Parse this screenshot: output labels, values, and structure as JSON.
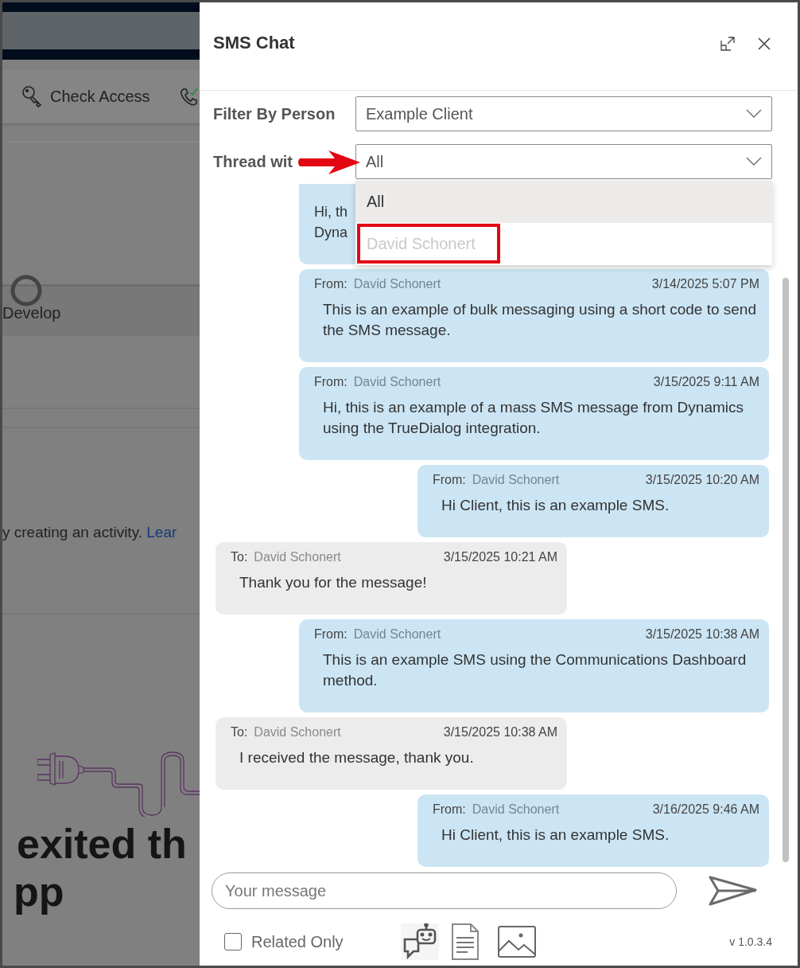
{
  "background": {
    "toolbar": [
      {
        "kind": "key",
        "label": "Check Access"
      },
      {
        "kind": "phone"
      }
    ],
    "stage": "Develop",
    "notice": {
      "text": "y creating an activity. ",
      "link": "Lear"
    },
    "heading": [
      "exited th",
      "pp"
    ]
  },
  "panel": {
    "title": "SMS Chat",
    "filters": [
      {
        "label": "Filter By Person",
        "value": "Example Client"
      },
      {
        "label": "Thread wit",
        "value": "All",
        "expanded": true
      }
    ],
    "options": [
      {
        "label": "All",
        "selected": true,
        "annotated": false
      },
      {
        "label": "David Schonert",
        "selected": false,
        "annotated": true
      }
    ],
    "messages": [
      {
        "kind": "out",
        "text": "Hi, th\nDyna"
      },
      {
        "kind": "out",
        "prefix": "From:",
        "name": "David Schonert",
        "time": "3/14/2025 5:07 PM",
        "text": "This is an example of bulk messaging using a short code to send the SMS message."
      },
      {
        "kind": "out",
        "prefix": "From:",
        "name": "David Schonert",
        "time": "3/15/2025 9:11 AM",
        "text": "Hi, this is an example of a mass SMS message from Dynamics using the TrueDialog integration."
      },
      {
        "kind": "out",
        "prefix": "From:",
        "name": "David Schonert",
        "time": "3/15/2025 10:20 AM",
        "text": "Hi Client, this is an example SMS."
      },
      {
        "kind": "in",
        "prefix": "To:",
        "name": "David Schonert",
        "time": "3/15/2025 10:21 AM",
        "text": "Thank you for the message!"
      },
      {
        "kind": "out",
        "prefix": "From:",
        "name": "David Schonert",
        "time": "3/15/2025 10:38 AM",
        "text": "This is an example SMS using the Communications Dashboard method."
      },
      {
        "kind": "in",
        "prefix": "To:",
        "name": "David Schonert",
        "time": "3/15/2025 10:38 AM",
        "text": "I received the message, thank you."
      },
      {
        "kind": "out",
        "prefix": "From:",
        "name": "David Schonert",
        "time": "3/16/2025 9:46 AM",
        "text": "Hi Client, this is an example SMS."
      }
    ],
    "composer": {
      "placeholder": "Your message"
    },
    "related_only": {
      "label": "Related Only",
      "checked": false
    },
    "version": "v 1.0.3.4"
  }
}
